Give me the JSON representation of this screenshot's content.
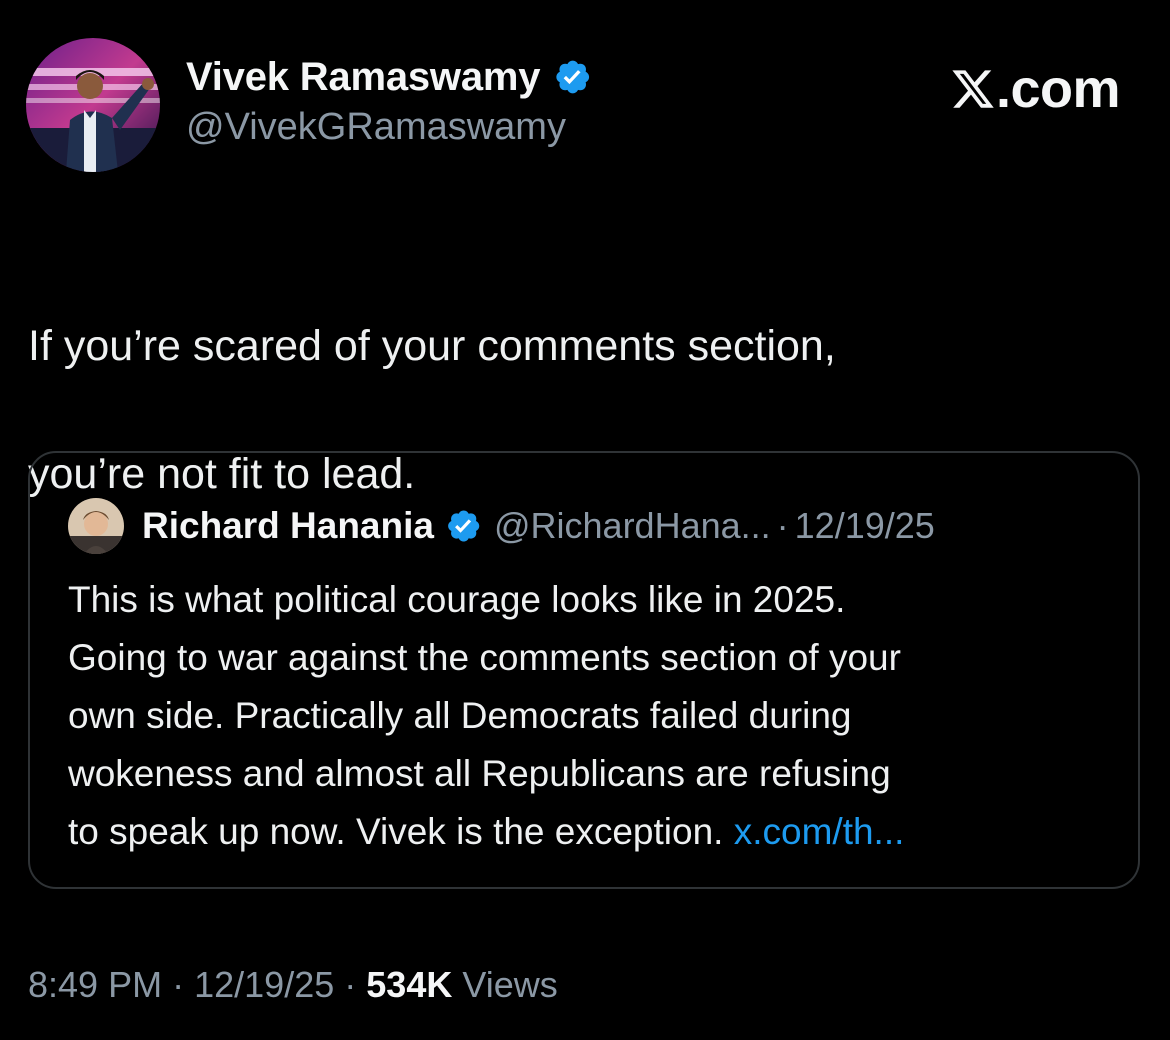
{
  "brand": {
    "text": ".com",
    "icon": "x-logo-icon"
  },
  "author": {
    "name": "Vivek Ramaswamy",
    "handle": "@VivekGRamaswamy",
    "verified": true,
    "avatar": "profile-photo"
  },
  "tweet": {
    "lines": [
      "If you’re scared of your comments section,",
      "you’re not fit to lead."
    ]
  },
  "quoted": {
    "name": "Richard Hanania",
    "handle": "@RichardHana...",
    "separator": "·",
    "date": "12/19/25",
    "verified": true,
    "lines": [
      "This is what political courage looks like in 2025.",
      "Going to war against the comments section of your",
      "own side. Practically all Democrats failed during",
      "wokeness and almost all Republicans are refusing",
      "to speak up now. Vivek is the exception. "
    ],
    "link": "x.com/th..."
  },
  "meta": {
    "time": "8:49 PM",
    "separator": "·",
    "date": "12/19/25",
    "views_count": "534K",
    "views_label": "Views"
  },
  "colors": {
    "background": "#000000",
    "primary_text": "#e7e9ea",
    "secondary_text": "#8b98a5",
    "link": "#1d9bf0",
    "verified_badge": "#1d9bf0",
    "border": "#2f3336"
  }
}
